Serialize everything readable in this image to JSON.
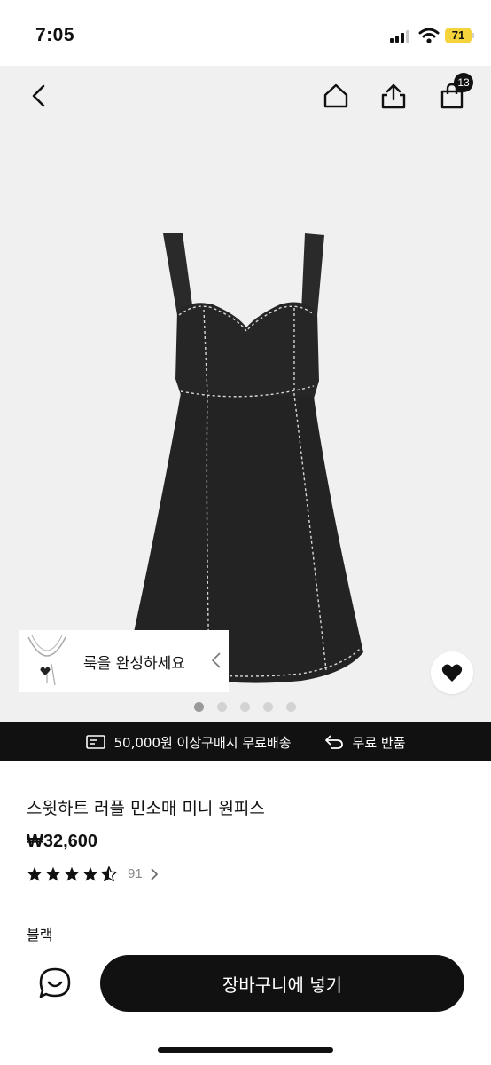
{
  "status_bar": {
    "time": "7:05",
    "battery": "71"
  },
  "header": {
    "cart_count": "13",
    "icons": [
      "back-icon",
      "home-icon",
      "share-icon",
      "cart-icon"
    ]
  },
  "look": {
    "label": "룩을 완성하세요"
  },
  "gallery": {
    "total": 5,
    "current": 1
  },
  "shipping": {
    "free_shipping": "50,000원 이상구매시 무료배송",
    "free_return": "무료 반품"
  },
  "product": {
    "title": "스윗하트 러플 민소매 미니 원피스",
    "price": "₩32,600",
    "rating": 4.5,
    "review_count": "91",
    "color": "블랙"
  },
  "actions": {
    "add_to_cart": "장바구니에 넣기"
  },
  "colors": {
    "accent": "#111111",
    "battery": "#f4d33c",
    "hero_bg": "#f0f0f0"
  }
}
